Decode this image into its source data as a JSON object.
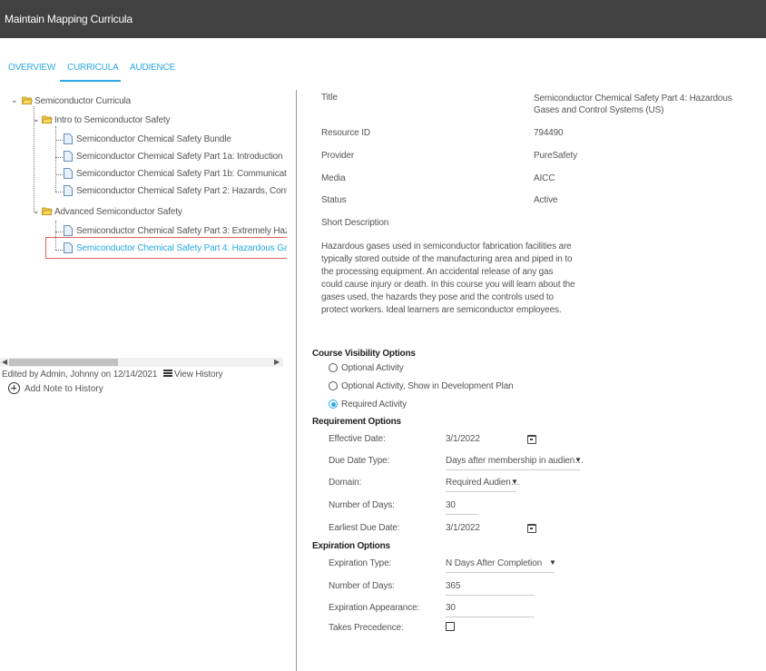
{
  "window": {
    "title": "Maintain Mapping Curricula"
  },
  "tabs": [
    {
      "label": "OVERVIEW",
      "active": false
    },
    {
      "label": "CURRICULA",
      "active": true
    },
    {
      "label": "AUDIENCE",
      "active": false
    }
  ],
  "tree": {
    "root": "Semiconductor Curricula",
    "groups": [
      {
        "label": "Intro to Semiconductor Safety",
        "items": [
          "Semiconductor Chemical Safety Bundle",
          "Semiconductor Chemical Safety Part 1a: Introduction",
          "Semiconductor Chemical Safety Part 1b: Communicat",
          "Semiconductor Chemical Safety Part 2: Hazards, Cont"
        ]
      },
      {
        "label": "Advanced Semiconductor Safety",
        "items": [
          "Semiconductor Chemical Safety Part 3: Extremely Haz",
          "Semiconductor Chemical Safety Part 4: Hazardous Ga"
        ]
      }
    ],
    "selected": "Semiconductor Chemical Safety Part 4: Hazardous Ga"
  },
  "history": {
    "edited": "Edited by Admin, Johnny on 12/14/2021",
    "view_history": "View History",
    "add_note": "Add Note to History"
  },
  "details": {
    "title_label": "Title",
    "title_value": "Semiconductor Chemical Safety Part 4: Hazardous Gases and Control Systems (US)",
    "resource_id_label": "Resource ID",
    "resource_id_value": "794490",
    "provider_label": "Provider",
    "provider_value": "PureSafety",
    "media_label": "Media",
    "media_value": "AICC",
    "status_label": "Status",
    "status_value": "Active",
    "short_description_label": "Short Description",
    "short_description_value": "Hazardous gases used in semiconductor fabrication facilities are typically stored outside of the manufacturing area and piped in to the processing equipment. An accidental release of any gas could cause injury or death. In this course you will learn about the gases used, the hazards they pose and the controls used to protect workers. Ideal learners are semiconductor employees."
  },
  "visibility": {
    "heading": "Course Visibility Options",
    "options": [
      {
        "label": "Optional Activity",
        "selected": false
      },
      {
        "label": "Optional Activity, Show in Development Plan",
        "selected": false
      },
      {
        "label": "Required Activity",
        "selected": true
      }
    ]
  },
  "requirement": {
    "heading": "Requirement Options",
    "effective_date_label": "Effective Date:",
    "effective_date_value": "3/1/2022",
    "due_date_type_label": "Due Date Type:",
    "due_date_type_value": "Days after membership in audien…",
    "domain_label": "Domain:",
    "domain_value": "Required Audien…",
    "number_of_days_label": "Number of Days:",
    "number_of_days_value": "30",
    "earliest_due_date_label": "Earliest Due Date:",
    "earliest_due_date_value": "3/1/2022"
  },
  "expiration": {
    "heading": "Expiration Options",
    "type_label": "Expiration Type:",
    "type_value": "N Days After Completion",
    "number_of_days_label": "Number of Days:",
    "number_of_days_value": "365",
    "appearance_label": "Expiration Appearance:",
    "appearance_value": "30",
    "takes_precedence_label": "Takes Precedence:",
    "takes_precedence_checked": false
  },
  "colors": {
    "accent": "#2aa8e0",
    "titlebar": "#414141",
    "selection_border": "#e06060"
  }
}
